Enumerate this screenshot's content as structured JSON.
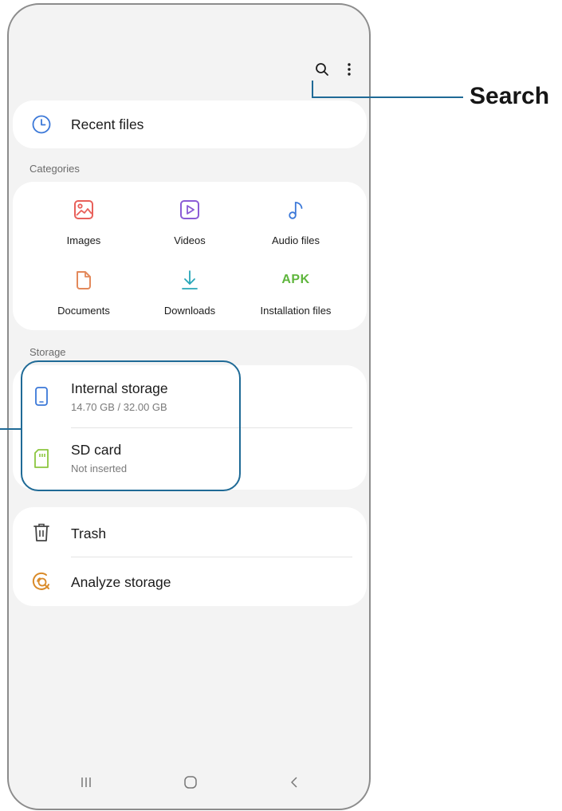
{
  "topbar": {
    "search_icon": "search-icon",
    "more_icon": "more-vertical-icon"
  },
  "recent": {
    "label": "Recent files",
    "icon": "clock-icon"
  },
  "categories": {
    "header": "Categories",
    "items": [
      {
        "label": "Images",
        "icon": "image-icon",
        "color": "#e8605a"
      },
      {
        "label": "Videos",
        "icon": "video-icon",
        "color": "#8b5bd6"
      },
      {
        "label": "Audio files",
        "icon": "music-note-icon",
        "color": "#3b78d8"
      },
      {
        "label": "Documents",
        "icon": "document-icon",
        "color": "#e3895b"
      },
      {
        "label": "Downloads",
        "icon": "download-icon",
        "color": "#27a6b8"
      },
      {
        "label": "Installation files",
        "icon": "apk-icon",
        "color": "#5fb63d",
        "glyph": "APK"
      }
    ]
  },
  "storage": {
    "header": "Storage",
    "items": [
      {
        "label": "Internal storage",
        "sub": "14.70 GB / 32.00 GB",
        "icon": "phone-icon",
        "color": "#3b78d8"
      },
      {
        "label": "SD card",
        "sub": "Not inserted",
        "icon": "sd-card-icon",
        "color": "#8cc63f"
      }
    ]
  },
  "tools": {
    "items": [
      {
        "label": "Trash",
        "icon": "trash-icon"
      },
      {
        "label": "Analyze storage",
        "icon": "analyze-storage-icon",
        "color": "#d98b2a"
      }
    ]
  },
  "navbar": {
    "recent_apps": "recent-apps-icon",
    "home": "home-icon",
    "back": "back-icon"
  },
  "callout": {
    "label": "Search"
  }
}
